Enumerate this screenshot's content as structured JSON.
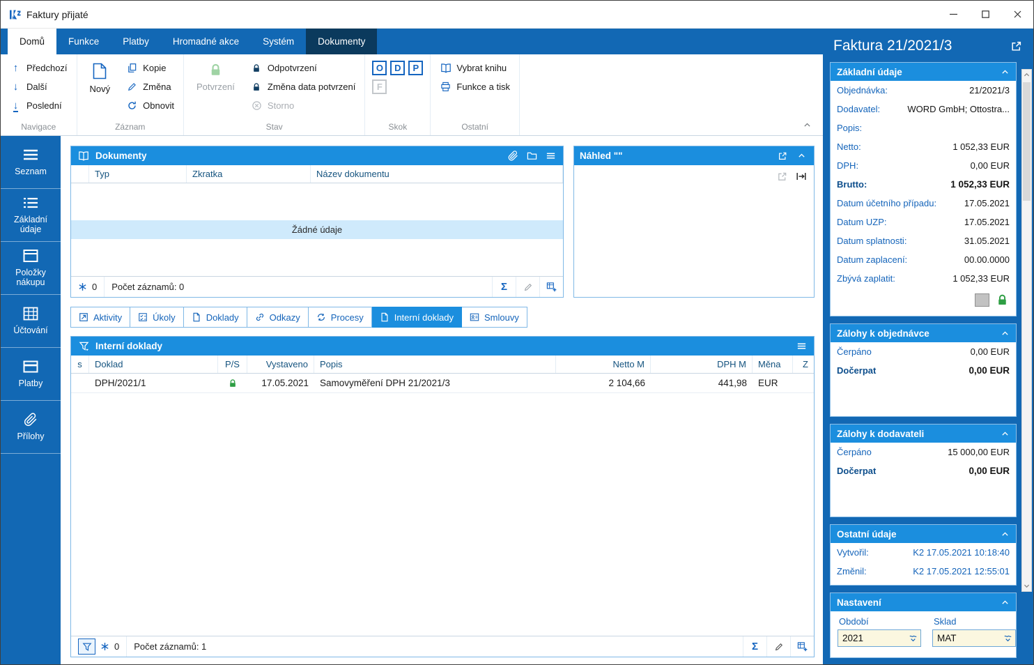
{
  "window": {
    "title": "Faktury přijaté"
  },
  "ribbon": {
    "tabs": [
      {
        "label": "Domů"
      },
      {
        "label": "Funkce"
      },
      {
        "label": "Platby"
      },
      {
        "label": "Hromadné akce"
      },
      {
        "label": "Systém"
      },
      {
        "label": "Dokumenty"
      }
    ],
    "navigace": {
      "label": "Navigace",
      "prev": "Předchozí",
      "next": "Další",
      "last": "Poslední"
    },
    "zaznam": {
      "label": "Záznam",
      "novy": "Nový",
      "kopie": "Kopie",
      "zmena": "Změna",
      "obnovit": "Obnovit"
    },
    "stav": {
      "label": "Stav",
      "potvrzeni": "Potvrzení",
      "odpotvrzeni": "Odpotvrzení",
      "zmena_data": "Změna data potvrzení",
      "storno": "Storno"
    },
    "skok": {
      "label": "Skok",
      "o": "O",
      "d": "D",
      "p": "P",
      "f": "F"
    },
    "ostatni": {
      "label": "Ostatní",
      "vybrat": "Vybrat knihu",
      "funkce_tisk": "Funkce a tisk"
    }
  },
  "sidebar": {
    "items": [
      {
        "label": "Seznam"
      },
      {
        "label": "Základní údaje"
      },
      {
        "label": "Položky nákupu"
      },
      {
        "label": "Účtování"
      },
      {
        "label": "Platby"
      },
      {
        "label": "Přílohy"
      }
    ]
  },
  "dokumenty": {
    "title": "Dokumenty",
    "columns": [
      "Typ",
      "Zkratka",
      "Název dokumentu"
    ],
    "empty": "Žádné údaje",
    "badge": "0",
    "count": "Počet záznamů: 0"
  },
  "nahled": {
    "title": "Náhled \"\""
  },
  "tabs2": {
    "items": [
      {
        "label": "Aktivity"
      },
      {
        "label": "Úkoly"
      },
      {
        "label": "Doklady"
      },
      {
        "label": "Odkazy"
      },
      {
        "label": "Procesy"
      },
      {
        "label": "Interní doklady"
      },
      {
        "label": "Smlouvy"
      }
    ]
  },
  "interni": {
    "title": "Interní doklady",
    "columns": {
      "s": "s",
      "doklad": "Doklad",
      "ps": "P/S",
      "vystaveno": "Vystaveno",
      "popis": "Popis",
      "netto": "Netto M",
      "dph": "DPH M",
      "mena": "Měna",
      "z": "Z"
    },
    "row": {
      "doklad": "DPH/2021/1",
      "vystaveno": "17.05.2021",
      "popis": "Samovyměření DPH 21/2021/3",
      "netto": "2 104,66",
      "dph": "441,98",
      "mena": "EUR"
    },
    "badge": "0",
    "count": "Počet záznamů: 1"
  },
  "detail": {
    "title": "Faktura 21/2021/3",
    "zakladni": {
      "title": "Základní údaje",
      "rows": [
        {
          "label": "Objednávka:",
          "value": "21/2021/3"
        },
        {
          "label": "Dodavatel:",
          "value": "WORD GmbH; Ottostra..."
        },
        {
          "label": "Popis:",
          "value": ""
        },
        {
          "label": "Netto:",
          "value": "1 052,33 EUR"
        },
        {
          "label": "DPH:",
          "value": "0,00 EUR"
        },
        {
          "label": "Brutto:",
          "value": "1 052,33 EUR"
        },
        {
          "label": "Datum účetního případu:",
          "value": "17.05.2021"
        },
        {
          "label": "Datum UZP:",
          "value": "17.05.2021"
        },
        {
          "label": "Datum splatnosti:",
          "value": "31.05.2021"
        },
        {
          "label": "Datum zaplacení:",
          "value": "00.00.0000"
        },
        {
          "label": "Zbývá zaplatit:",
          "value": "1 052,33 EUR"
        }
      ]
    },
    "zalohy_obj": {
      "title": "Zálohy k objednávce",
      "cerpano_label": "Čerpáno",
      "cerpano": "0,00 EUR",
      "docerpat_label": "Dočerpat",
      "docerpat": "0,00 EUR"
    },
    "zalohy_dod": {
      "title": "Zálohy k dodavateli",
      "cerpano_label": "Čerpáno",
      "cerpano": "15 000,00 EUR",
      "docerpat_label": "Dočerpat",
      "docerpat": "0,00 EUR"
    },
    "ostatni": {
      "title": "Ostatní údaje",
      "vytvoril_label": "Vytvořil:",
      "vytvoril": "K2 17.05.2021 10:18:40",
      "zmenil_label": "Změnil:",
      "zmenil": "K2 17.05.2021 12:55:01"
    },
    "nastaveni": {
      "title": "Nastavení",
      "obdobi_label": "Období",
      "obdobi": "2021",
      "sklad_label": "Sklad",
      "sklad": "MAT"
    }
  }
}
